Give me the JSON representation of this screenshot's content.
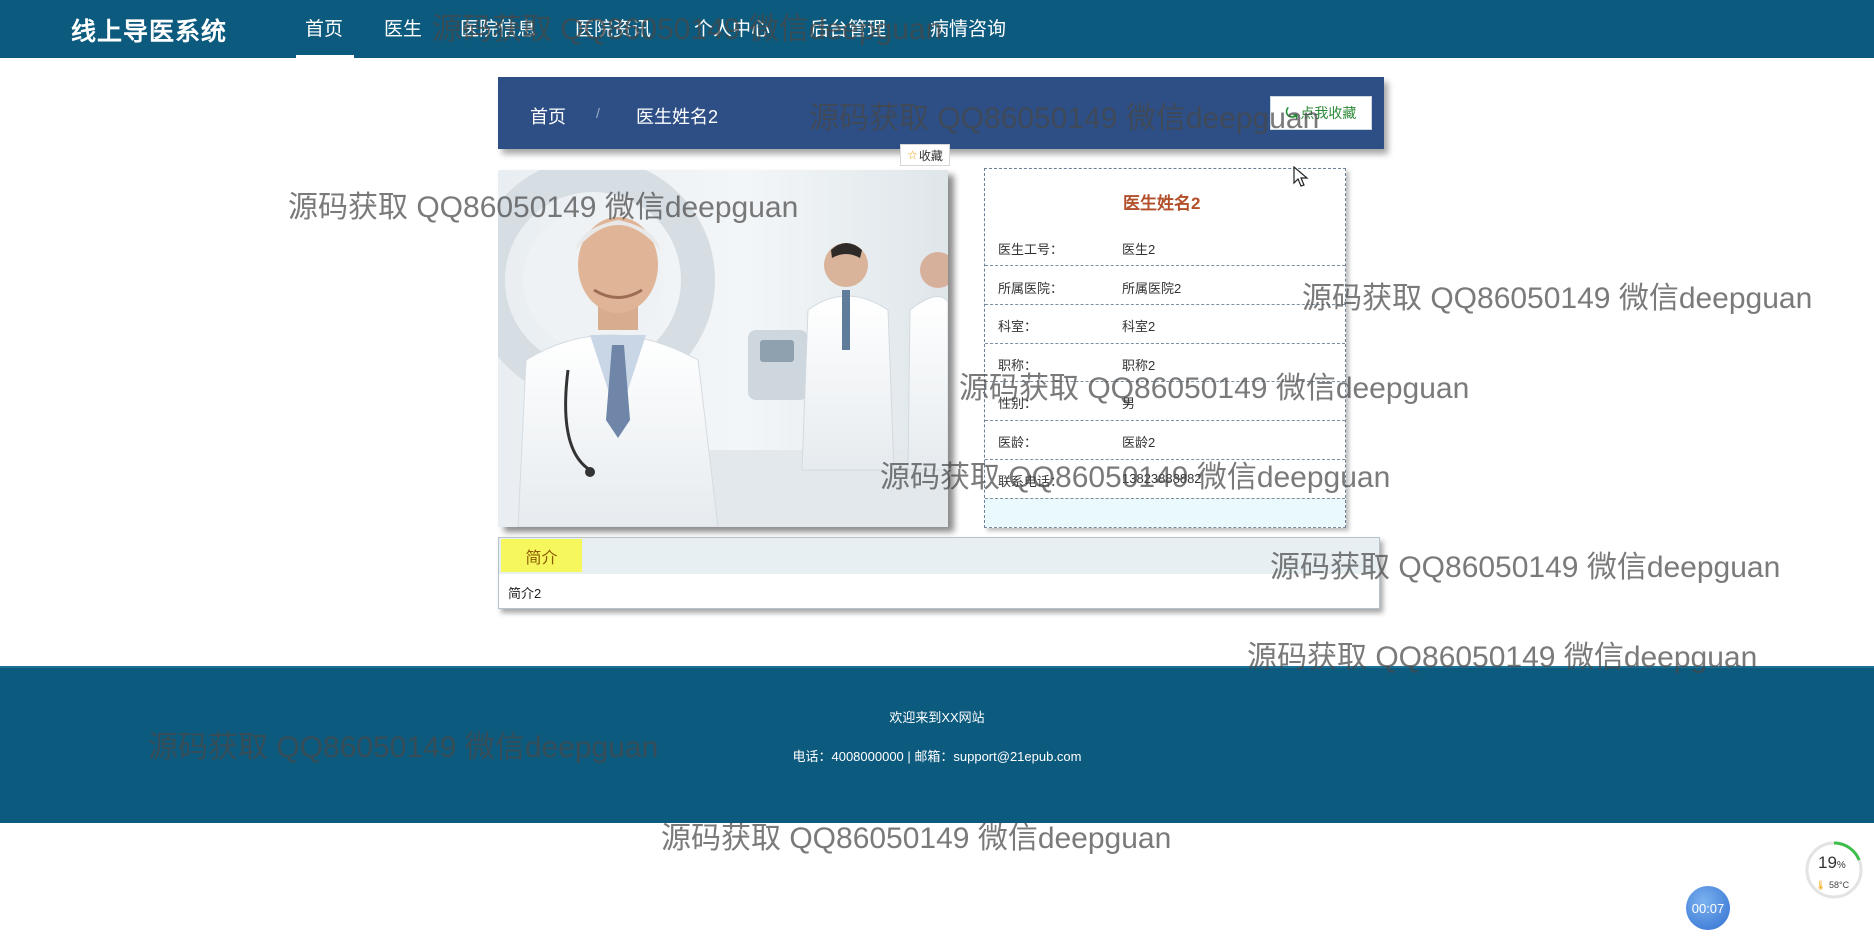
{
  "nav": {
    "brand": "线上导医系统",
    "items": [
      {
        "label": "首页"
      },
      {
        "label": "医生"
      },
      {
        "label": "医院信息"
      },
      {
        "label": "医院资讯"
      },
      {
        "label": "个人中心"
      },
      {
        "label": "后台管理"
      },
      {
        "label": "病情咨询"
      }
    ]
  },
  "breadcrumb": {
    "home": "首页",
    "separator": "/",
    "current": "医生姓名2",
    "favorite_button": "点我收藏"
  },
  "photo_tag": {
    "icon": "star-icon",
    "label": "收藏"
  },
  "doctor": {
    "name": "医生姓名2",
    "fields": [
      {
        "label": "医生工号：",
        "value": "医生2"
      },
      {
        "label": "所属医院：",
        "value": "所属医院2"
      },
      {
        "label": "科室：",
        "value": "科室2"
      },
      {
        "label": "职称：",
        "value": "职称2"
      },
      {
        "label": "性别：",
        "value": "男"
      },
      {
        "label": "医龄：",
        "value": "医龄2"
      },
      {
        "label": "联系电话：",
        "value": "13823888882"
      }
    ]
  },
  "intro": {
    "tab": "简介",
    "content": "简介2"
  },
  "footer": {
    "welcome": "欢迎来到XX网站",
    "contact": "电话：4008000000 | 邮箱：support@21epub.com"
  },
  "watermark": "源码获取 QQ86050149 微信deepguan",
  "widgets": {
    "cpu_percent": "19",
    "cpu_unit": "%",
    "cpu_usage_fraction": 0.19,
    "temperature": "58°C",
    "timer": "00:07"
  },
  "colors": {
    "header_bg": "#0c5a7e",
    "breadcrumb_bg": "#2d4f86",
    "doctor_name": "#b2502b",
    "intro_tab_bg": "#f6f75d"
  }
}
